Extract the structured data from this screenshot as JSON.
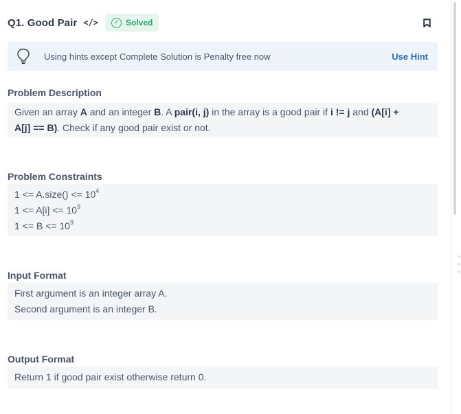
{
  "header": {
    "title": "Q1. Good Pair",
    "code_icon": "</>",
    "solved_label": "Solved",
    "icons": [
      "code-icon",
      "check-circle-icon",
      "bookmark-icon"
    ]
  },
  "hint": {
    "text": "Using hints except Complete Solution is Penalty free now",
    "action_label": "Use Hint",
    "icon": "lightbulb-icon"
  },
  "sections": {
    "description": {
      "title": "Problem Description",
      "parts": [
        "Given an array ",
        "A",
        " and an integer ",
        "B",
        ". A ",
        "pair(i, j)",
        " in the array is a good pair if ",
        "i != j",
        " and ",
        "(A[i] +",
        "A[j] == B)",
        ". Check if any good pair exist or not."
      ]
    },
    "constraints": {
      "title": "Problem Constraints",
      "lines": [
        {
          "base": "1 <= A.size() <= 10",
          "sup": "4"
        },
        {
          "base": "1 <= A[i] <= 10",
          "sup": "9"
        },
        {
          "base": "1 <= B <= 10",
          "sup": "9"
        }
      ]
    },
    "input_format": {
      "title": "Input Format",
      "lines": [
        "First argument is an integer array A.",
        "Second argument is an integer B."
      ]
    },
    "output_format": {
      "title": "Output Format",
      "lines": [
        "Return 1 if good pair exist otherwise return 0."
      ]
    }
  },
  "colors": {
    "accent": "#2b6cb0",
    "solved_green": "#2aa66a",
    "solved_bg": "#e6f6ee",
    "hint_bg": "#eef4fa",
    "box_bg": "#f4f5f7",
    "text": "#4a5568"
  }
}
